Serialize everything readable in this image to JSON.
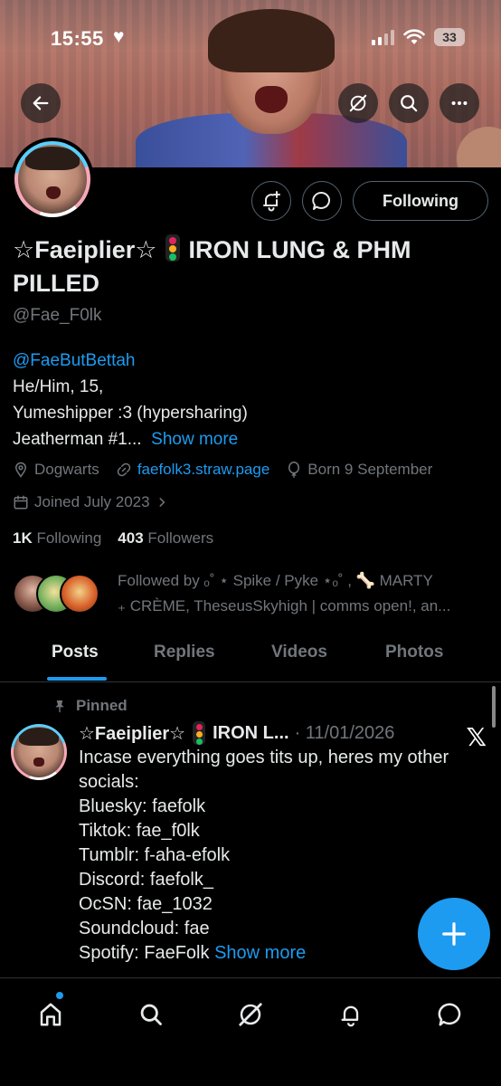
{
  "status_bar": {
    "time": "15:55",
    "battery": "33"
  },
  "header": {
    "back_icon": "arrow-left-icon",
    "grok_icon": "grok-icon",
    "search_icon": "search-icon",
    "more_icon": "more-horizontal-icon"
  },
  "profile": {
    "display_name_prefix": "☆Faeiplier☆",
    "display_name_suffix": "IRON LUNG & PHM PILLED",
    "handle": "@Fae_F0lk",
    "bio_mention": "@FaeButBettah",
    "bio_line2": "He/Him, 15,",
    "bio_line3": "Yumeshipper :3 (hypersharing)",
    "bio_line4": "Jeatherman #1...",
    "show_more": "Show more",
    "location": "Dogwarts",
    "website": "faefolk3.straw.page",
    "birthday": "Born 9 September",
    "joined": "Joined July 2023",
    "following_count": "1K",
    "following_label": "Following",
    "followers_count": "403",
    "followers_label": "Followers",
    "followed_by_line1": "Followed by ₒ˚ ⋆ Spike / Pyke ⋆ₒ˚ , 🦴 MARTY",
    "followed_by_line2": "₊ CRÈME, TheseusSkyhigh | comms open!, an..."
  },
  "actions": {
    "following_button": "Following",
    "notify_icon": "bell-plus-icon",
    "message_icon": "message-icon"
  },
  "tabs": [
    "Posts",
    "Replies",
    "Videos",
    "Photos"
  ],
  "post": {
    "pinned_label": "Pinned",
    "author_prefix": "☆Faeiplier☆",
    "author_suffix": "IRON L...",
    "time": "· 11/01/2026",
    "lines": [
      "Incase everything goes tits up, heres my other socials:",
      "Bluesky: faefolk",
      "Tiktok: fae_f0lk",
      "Tumblr: f-aha-efolk",
      "Discord: faefolk_",
      "OcSN: fae_1032",
      "Soundcloud: fae"
    ],
    "last_line": "Spotify: FaeFolk",
    "show_more": "Show more"
  },
  "bottom_nav": [
    "home-icon",
    "search-icon",
    "grok-icon",
    "bell-icon",
    "message-icon"
  ],
  "colors": {
    "accent": "#1d9bf0",
    "muted": "#71767b",
    "text": "#e7e9ea",
    "bg": "#000000"
  }
}
